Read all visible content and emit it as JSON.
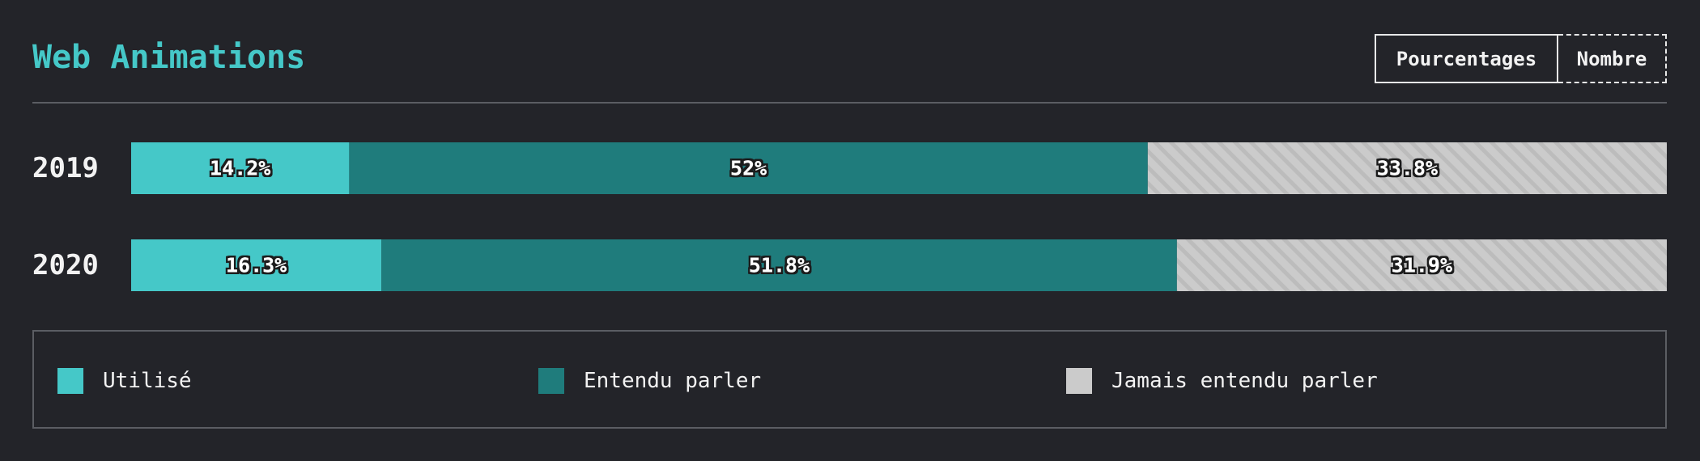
{
  "chart_data": {
    "type": "bar",
    "orientation": "horizontal",
    "stacked": true,
    "normalized": true,
    "title": "Web Animations",
    "categories": [
      "2019",
      "2020"
    ],
    "series": [
      {
        "name": "Utilisé",
        "values": [
          14.2,
          16.3
        ],
        "color": "#45c8c8",
        "labels": [
          "14.2%",
          "16.3%"
        ]
      },
      {
        "name": "Entendu parler",
        "values": [
          52,
          51.8
        ],
        "color": "#1f7c7c",
        "labels": [
          "52%",
          "51.8%"
        ]
      },
      {
        "name": "Jamais entendu parler",
        "values": [
          33.8,
          31.9
        ],
        "color": "#cbcbcb",
        "pattern": "diagonal-hatch",
        "labels": [
          "33.8%",
          "31.9%"
        ]
      }
    ],
    "xlim": [
      0,
      100
    ],
    "unit": "%",
    "grid": false,
    "legend_position": "bottom"
  },
  "controls": {
    "percentages_label": "Pourcentages",
    "count_label": "Nombre",
    "active": "Pourcentages"
  }
}
